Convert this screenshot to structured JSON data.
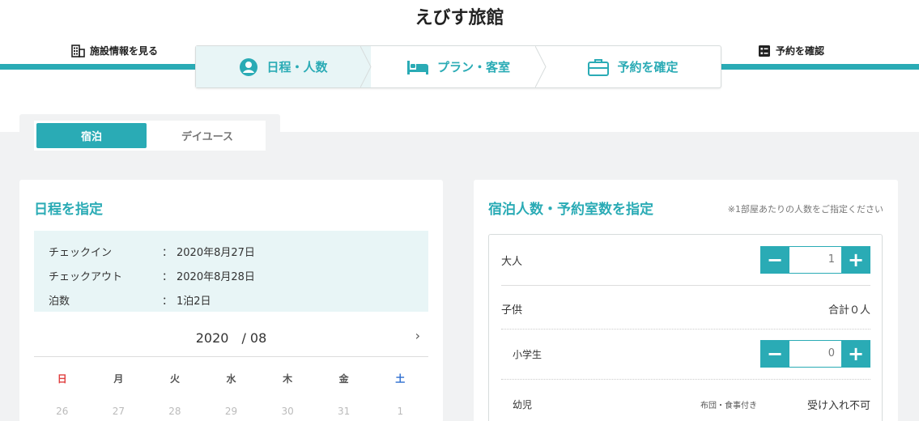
{
  "site": {
    "title": "えびす旅館"
  },
  "links": {
    "facility": "施設情報を見る",
    "confirm": "予約を確認"
  },
  "steps": [
    {
      "label": "日程・人数",
      "icon": "user-circle-icon",
      "active": true
    },
    {
      "label": "プラン・客室",
      "icon": "bed-icon",
      "active": false
    },
    {
      "label": "予約を確定",
      "icon": "briefcase-icon",
      "active": false
    }
  ],
  "tabs": {
    "stay": "宿泊",
    "dayuse": "デイユース"
  },
  "schedule": {
    "title": "日程を指定",
    "rows": [
      {
        "key": "チェックイン",
        "colon": "：",
        "value": "2020年8月27日"
      },
      {
        "key": "チェックアウト",
        "colon": "：",
        "value": "2020年8月28日"
      },
      {
        "key": "泊数",
        "colon": "：",
        "value": "1泊2日"
      }
    ],
    "calendar": {
      "month": "2020　/ 08",
      "next": "›",
      "weekdays": [
        "日",
        "月",
        "火",
        "水",
        "木",
        "金",
        "土"
      ],
      "first_row": [
        "26",
        "27",
        "28",
        "29",
        "30",
        "31",
        "1"
      ]
    }
  },
  "guests": {
    "title": "宿泊人数・予約室数を指定",
    "note": "※1部屋あたりの人数をご指定ください",
    "adult": {
      "label": "大人",
      "value": "1"
    },
    "child": {
      "label": "子供",
      "total": "合計０人"
    },
    "elementary": {
      "label": "小学生",
      "value": "0"
    },
    "infant": {
      "label": "幼児",
      "note": "布団・食事付き",
      "status": "受け入れ不可"
    },
    "minus": "−",
    "plus": "+"
  },
  "colors": {
    "accent": "#2aabb5",
    "sunday": "#e04040",
    "saturday": "#2f6fd0"
  }
}
